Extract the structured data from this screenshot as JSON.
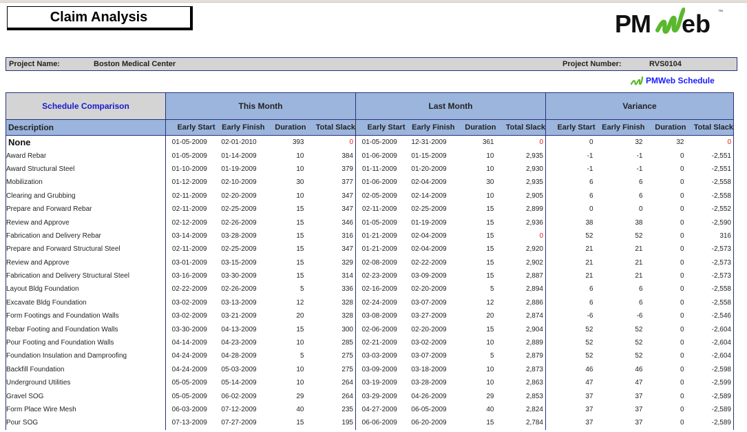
{
  "report": {
    "title": "Claim Analysis",
    "logo_text": "PMWeb",
    "logo_tm": "™",
    "accent_green": "#5ab82e",
    "header_blue": "#9cb5dd",
    "border_navy": "#26307a",
    "zero_slack_color": "#e02020"
  },
  "project": {
    "name_label": "Project Name:",
    "name_value": "Boston Medical Center",
    "number_label": "Project Number:",
    "number_value": "RVS0104"
  },
  "schedule_link": {
    "icon": "pmweb-w-icon",
    "label": "PMWeb Schedule"
  },
  "table": {
    "group_headers": {
      "comparison": "Schedule Comparison",
      "this_month": "This Month",
      "last_month": "Last Month",
      "variance": "Variance"
    },
    "columns": {
      "description": "Description",
      "early_start": "Early Start",
      "early_finish": "Early Finish",
      "duration": "Duration",
      "total_slack": "Total Slack"
    },
    "rows": [
      {
        "desc": "None",
        "group": true,
        "tm": [
          "01-05-2009",
          "02-01-2010",
          "393",
          "0"
        ],
        "lm": [
          "01-05-2009",
          "12-31-2009",
          "361",
          "0"
        ],
        "v": [
          "0",
          "32",
          "32",
          "0"
        ]
      },
      {
        "desc": "Award Rebar",
        "tm": [
          "01-05-2009",
          "01-14-2009",
          "10",
          "384"
        ],
        "lm": [
          "01-06-2009",
          "01-15-2009",
          "10",
          "2,935"
        ],
        "v": [
          "-1",
          "-1",
          "0",
          "-2,551"
        ]
      },
      {
        "desc": "Award Structural Steel",
        "tm": [
          "01-10-2009",
          "01-19-2009",
          "10",
          "379"
        ],
        "lm": [
          "01-11-2009",
          "01-20-2009",
          "10",
          "2,930"
        ],
        "v": [
          "-1",
          "-1",
          "0",
          "-2,551"
        ]
      },
      {
        "desc": "Mobilization",
        "tm": [
          "01-12-2009",
          "02-10-2009",
          "30",
          "377"
        ],
        "lm": [
          "01-06-2009",
          "02-04-2009",
          "30",
          "2,935"
        ],
        "v": [
          "6",
          "6",
          "0",
          "-2,558"
        ]
      },
      {
        "desc": "Clearing and Grubbing",
        "tm": [
          "02-11-2009",
          "02-20-2009",
          "10",
          "347"
        ],
        "lm": [
          "02-05-2009",
          "02-14-2009",
          "10",
          "2,905"
        ],
        "v": [
          "6",
          "6",
          "0",
          "-2,558"
        ]
      },
      {
        "desc": "Prepare and Forward Rebar",
        "tm": [
          "02-11-2009",
          "02-25-2009",
          "15",
          "347"
        ],
        "lm": [
          "02-11-2009",
          "02-25-2009",
          "15",
          "2,899"
        ],
        "v": [
          "0",
          "0",
          "0",
          "-2,552"
        ]
      },
      {
        "desc": "Review and Approve",
        "tm": [
          "02-12-2009",
          "02-26-2009",
          "15",
          "346"
        ],
        "lm": [
          "01-05-2009",
          "01-19-2009",
          "15",
          "2,936"
        ],
        "v": [
          "38",
          "38",
          "0",
          "-2,590"
        ]
      },
      {
        "desc": "Fabrication and Delivery Rebar",
        "tm": [
          "03-14-2009",
          "03-28-2009",
          "15",
          "316"
        ],
        "lm": [
          "01-21-2009",
          "02-04-2009",
          "15",
          "0"
        ],
        "v": [
          "52",
          "52",
          "0",
          "316"
        ]
      },
      {
        "desc": "Prepare and Forward Structural Steel",
        "tm": [
          "02-11-2009",
          "02-25-2009",
          "15",
          "347"
        ],
        "lm": [
          "01-21-2009",
          "02-04-2009",
          "15",
          "2,920"
        ],
        "v": [
          "21",
          "21",
          "0",
          "-2,573"
        ]
      },
      {
        "desc": "Review and Approve",
        "tm": [
          "03-01-2009",
          "03-15-2009",
          "15",
          "329"
        ],
        "lm": [
          "02-08-2009",
          "02-22-2009",
          "15",
          "2,902"
        ],
        "v": [
          "21",
          "21",
          "0",
          "-2,573"
        ]
      },
      {
        "desc": "Fabrication and Delivery Structural Steel",
        "tm": [
          "03-16-2009",
          "03-30-2009",
          "15",
          "314"
        ],
        "lm": [
          "02-23-2009",
          "03-09-2009",
          "15",
          "2,887"
        ],
        "v": [
          "21",
          "21",
          "0",
          "-2,573"
        ]
      },
      {
        "desc": "Layout Bldg Foundation",
        "tm": [
          "02-22-2009",
          "02-26-2009",
          "5",
          "336"
        ],
        "lm": [
          "02-16-2009",
          "02-20-2009",
          "5",
          "2,894"
        ],
        "v": [
          "6",
          "6",
          "0",
          "-2,558"
        ]
      },
      {
        "desc": "Excavate Bldg Foundation",
        "tm": [
          "03-02-2009",
          "03-13-2009",
          "12",
          "328"
        ],
        "lm": [
          "02-24-2009",
          "03-07-2009",
          "12",
          "2,886"
        ],
        "v": [
          "6",
          "6",
          "0",
          "-2,558"
        ]
      },
      {
        "desc": "Form Footings and Foundation Walls",
        "tm": [
          "03-02-2009",
          "03-21-2009",
          "20",
          "328"
        ],
        "lm": [
          "03-08-2009",
          "03-27-2009",
          "20",
          "2,874"
        ],
        "v": [
          "-6",
          "-6",
          "0",
          "-2,546"
        ]
      },
      {
        "desc": "Rebar Footing and Foundation Walls",
        "tm": [
          "03-30-2009",
          "04-13-2009",
          "15",
          "300"
        ],
        "lm": [
          "02-06-2009",
          "02-20-2009",
          "15",
          "2,904"
        ],
        "v": [
          "52",
          "52",
          "0",
          "-2,604"
        ]
      },
      {
        "desc": "Pour Footing and Foundation Walls",
        "tm": [
          "04-14-2009",
          "04-23-2009",
          "10",
          "285"
        ],
        "lm": [
          "02-21-2009",
          "03-02-2009",
          "10",
          "2,889"
        ],
        "v": [
          "52",
          "52",
          "0",
          "-2,604"
        ]
      },
      {
        "desc": "Foundation Insulation and Damproofing",
        "tm": [
          "04-24-2009",
          "04-28-2009",
          "5",
          "275"
        ],
        "lm": [
          "03-03-2009",
          "03-07-2009",
          "5",
          "2,879"
        ],
        "v": [
          "52",
          "52",
          "0",
          "-2,604"
        ]
      },
      {
        "desc": "Backfill Foundation",
        "tm": [
          "04-24-2009",
          "05-03-2009",
          "10",
          "275"
        ],
        "lm": [
          "03-09-2009",
          "03-18-2009",
          "10",
          "2,873"
        ],
        "v": [
          "46",
          "46",
          "0",
          "-2,598"
        ]
      },
      {
        "desc": "Underground Utilities",
        "tm": [
          "05-05-2009",
          "05-14-2009",
          "10",
          "264"
        ],
        "lm": [
          "03-19-2009",
          "03-28-2009",
          "10",
          "2,863"
        ],
        "v": [
          "47",
          "47",
          "0",
          "-2,599"
        ]
      },
      {
        "desc": "Gravel SOG",
        "tm": [
          "05-05-2009",
          "06-02-2009",
          "29",
          "264"
        ],
        "lm": [
          "03-29-2009",
          "04-26-2009",
          "29",
          "2,853"
        ],
        "v": [
          "37",
          "37",
          "0",
          "-2,589"
        ]
      },
      {
        "desc": "Form Place Wire Mesh",
        "tm": [
          "06-03-2009",
          "07-12-2009",
          "40",
          "235"
        ],
        "lm": [
          "04-27-2009",
          "06-05-2009",
          "40",
          "2,824"
        ],
        "v": [
          "37",
          "37",
          "0",
          "-2,589"
        ]
      },
      {
        "desc": "Pour SOG",
        "tm": [
          "07-13-2009",
          "07-27-2009",
          "15",
          "195"
        ],
        "lm": [
          "06-06-2009",
          "06-20-2009",
          "15",
          "2,784"
        ],
        "v": [
          "37",
          "37",
          "0",
          "-2,589"
        ]
      }
    ]
  }
}
